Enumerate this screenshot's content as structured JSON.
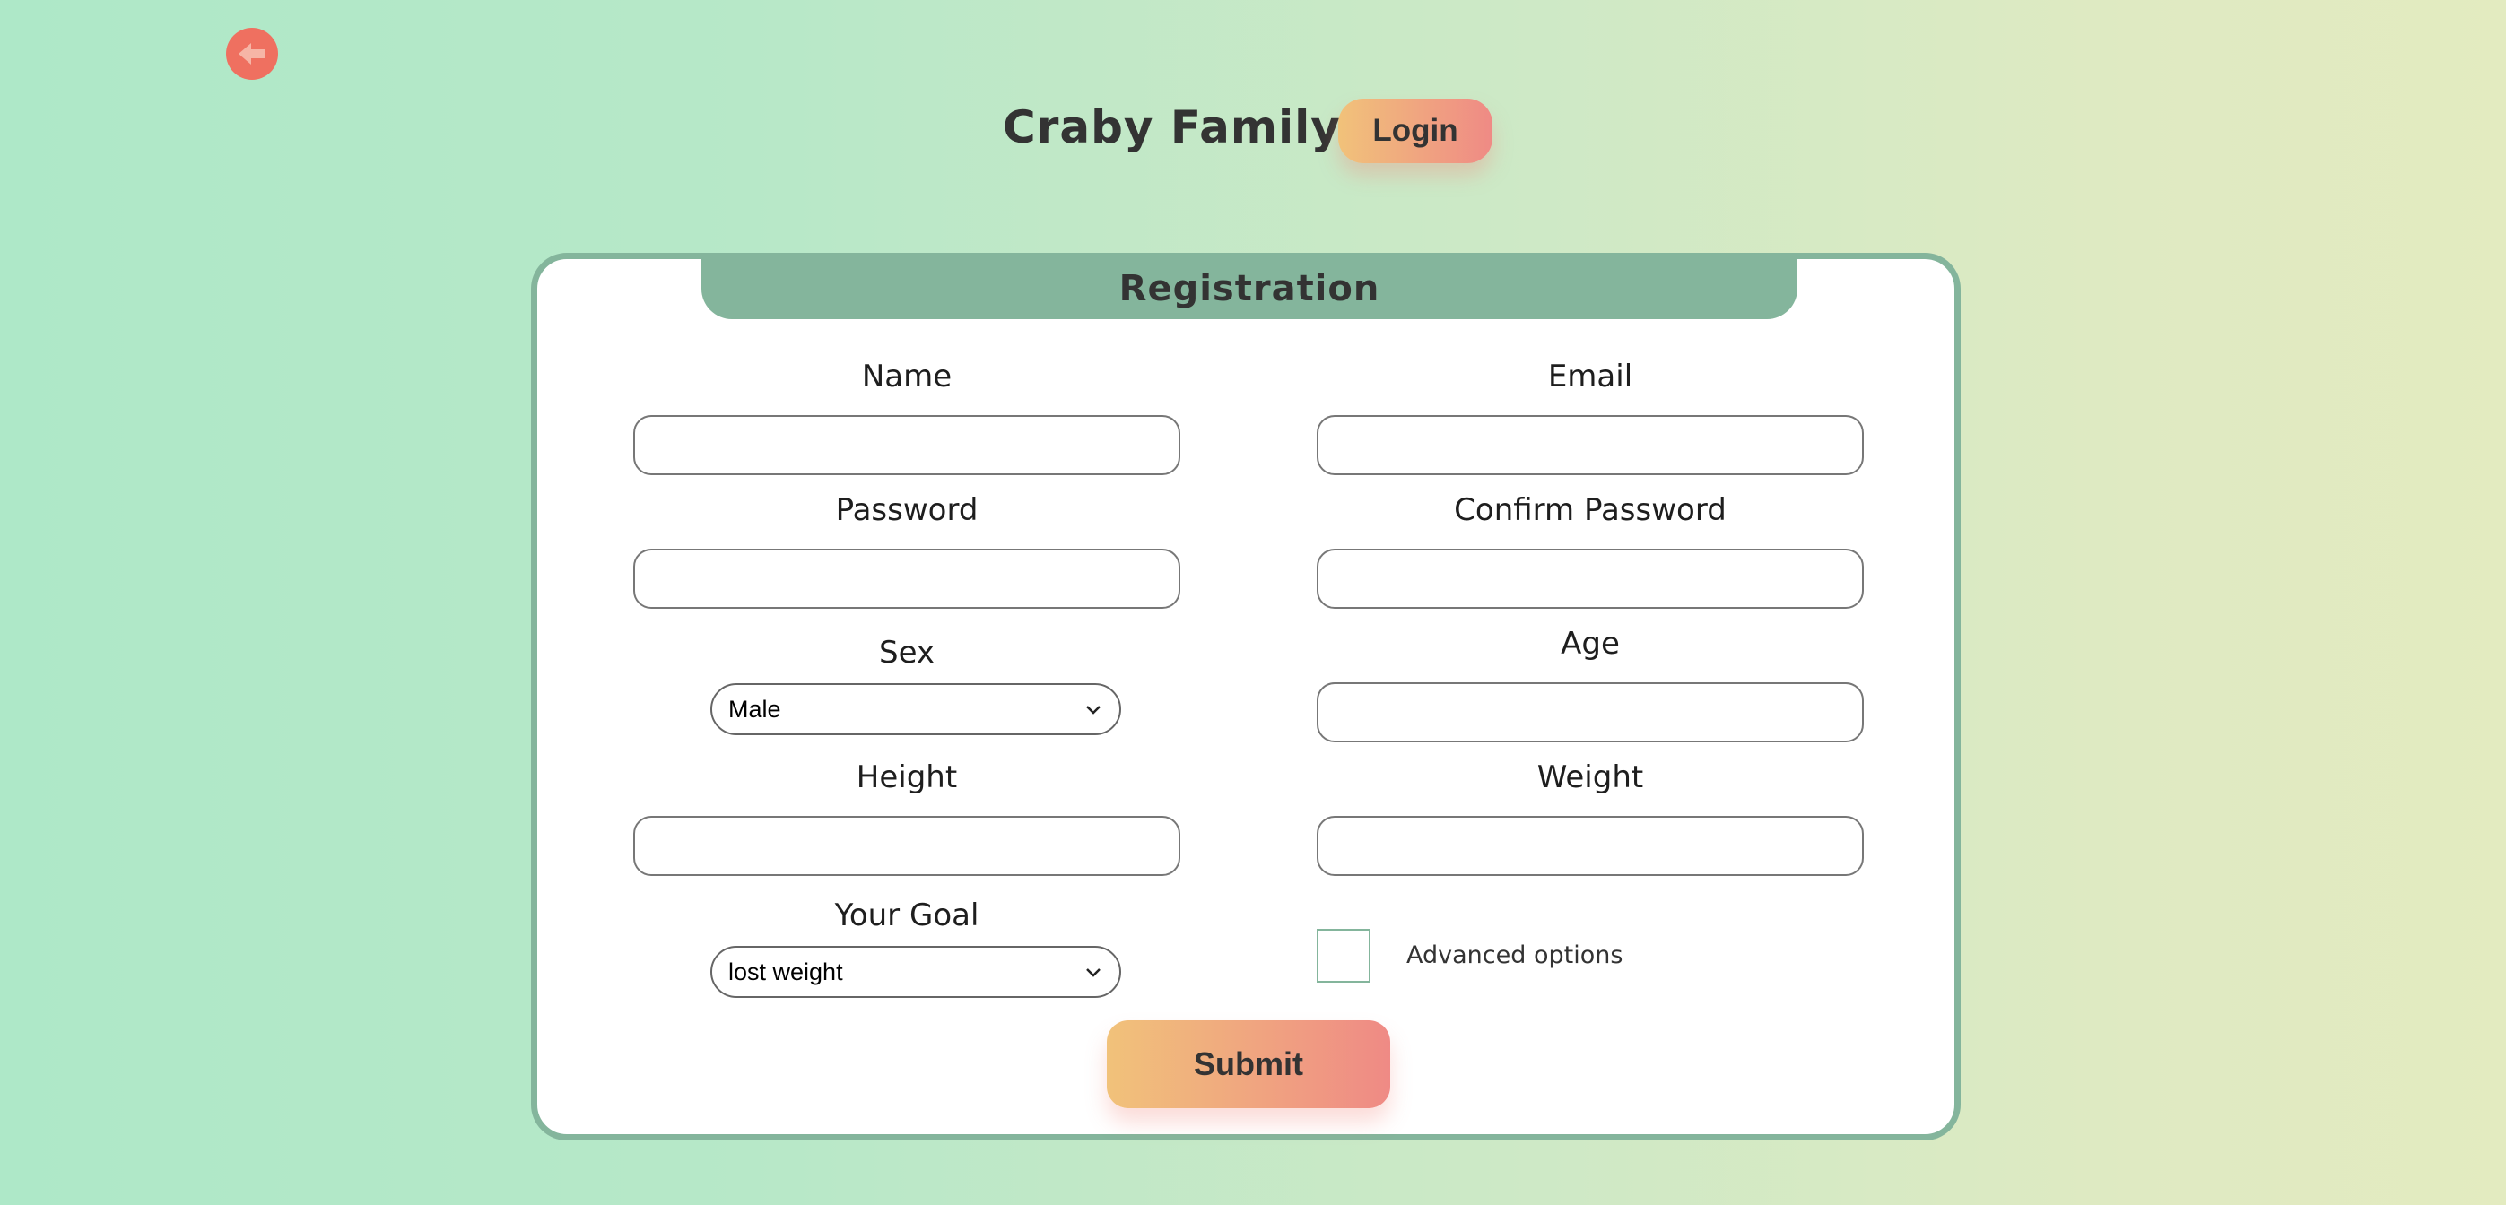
{
  "header": {
    "back_icon": "arrow-left-icon",
    "brand": "Craby Family",
    "login_label": "Login"
  },
  "form": {
    "title": "Registration",
    "fields": {
      "name": {
        "label": "Name",
        "value": "",
        "placeholder": ""
      },
      "email": {
        "label": "Email",
        "value": "",
        "placeholder": ""
      },
      "password": {
        "label": "Password",
        "value": "",
        "placeholder": ""
      },
      "confirm_password": {
        "label": "Confirm Password",
        "value": "",
        "placeholder": ""
      },
      "sex": {
        "label": "Sex",
        "selected": "Male"
      },
      "age": {
        "label": "Age",
        "value": "",
        "placeholder": ""
      },
      "height": {
        "label": "Height",
        "value": "",
        "placeholder": ""
      },
      "weight": {
        "label": "Weight",
        "value": "",
        "placeholder": ""
      },
      "goal": {
        "label": "Your Goal",
        "selected": "lost weight"
      }
    },
    "advanced_options": {
      "label": "Advanced options",
      "checked": false
    },
    "submit_label": "Submit"
  },
  "colors": {
    "accent_green": "#84b59c",
    "back_button": "#ef7060",
    "button_gradient_start": "#f1c27a",
    "button_gradient_end": "#ef8a85"
  }
}
